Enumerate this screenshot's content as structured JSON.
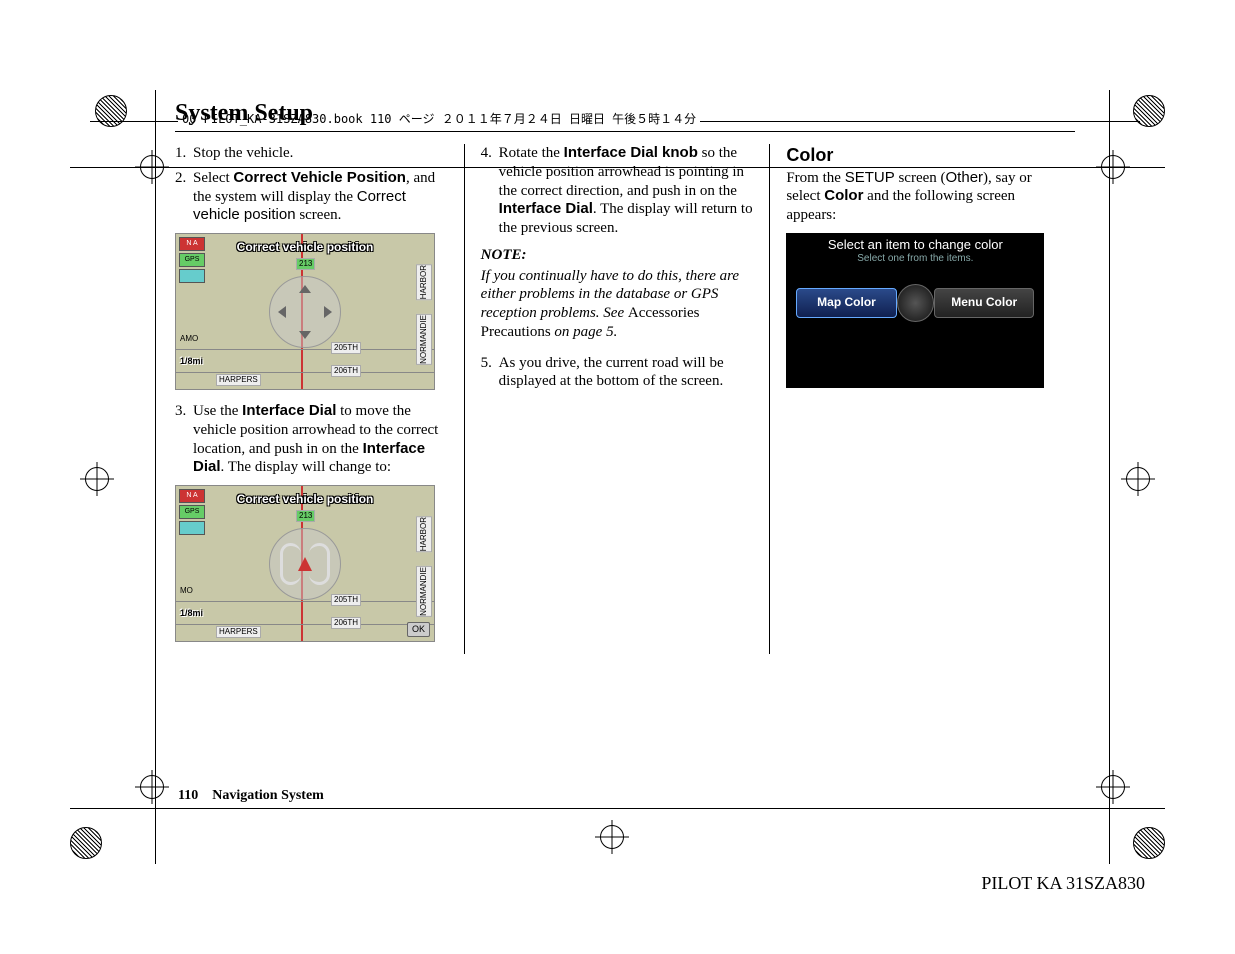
{
  "header_strip": "00 PILOT_KA-31SZA830.book  110 ページ  ２０１１年７月２４日  日曜日  午後５時１４分",
  "title": "System Setup",
  "col1": {
    "step1_num": "1.",
    "step1": "Stop the vehicle.",
    "step2_num": "2.",
    "step2_a": "Select ",
    "step2_b": "Correct Vehicle Position",
    "step2_c": ", and the system will display the ",
    "step2_d": "Correct vehicle position",
    "step2_e": " screen.",
    "shot1": {
      "title": "Correct vehicle position",
      "scale": "1/8mi",
      "na": "N A",
      "gps": "GPS",
      "road_205": "205TH",
      "road_206": "206TH",
      "road_harpers": "HARPERS",
      "road_amo": "AMO",
      "road_harbor": "HARBOR",
      "road_normandie": "NORMANDIE",
      "hwy": "213"
    },
    "step3_num": "3.",
    "step3_a": "Use the ",
    "step3_b": "Interface Dial",
    "step3_c": " to move the vehicle position arrowhead to the correct location, and push in on the ",
    "step3_d": "Interface Dial",
    "step3_e": ". The display will change to:",
    "shot2": {
      "title": "Correct vehicle position",
      "scale": "1/8mi",
      "ok": "OK",
      "road_205": "205TH",
      "road_206": "206TH",
      "road_harpers": "HARPERS",
      "road_mo": "MO",
      "road_harbor": "HARBOR",
      "road_normandie": "NORMANDIE",
      "hwy": "213"
    }
  },
  "col2": {
    "step4_num": "4.",
    "step4_a": "Rotate the ",
    "step4_b": "Interface Dial knob",
    "step4_c": " so the vehicle position arrowhead is pointing in the correct direction, and push in on the ",
    "step4_d": "Interface Dial",
    "step4_e": ". The display will return to the previous screen.",
    "note_head": "NOTE:",
    "note_a": "If you continually have to do this, there are either problems in the database or GPS reception problems. See ",
    "note_b": "Accessories Precautions",
    "note_c": " on page 5.",
    "step5_num": "5.",
    "step5": "As you drive, the current road will be displayed at the bottom of the screen."
  },
  "col3": {
    "heading": "Color",
    "intro_a": "From the ",
    "intro_b": "SETUP",
    "intro_c": " screen (",
    "intro_d": "Other",
    "intro_e": "), say or select ",
    "intro_f": "Color",
    "intro_g": " and the following screen appears:",
    "shot": {
      "title": "Select an item to change color",
      "sub": "Select one from the items.",
      "btn_map": "Map Color",
      "btn_menu": "Menu Color"
    }
  },
  "footer": {
    "page": "110",
    "section": "Navigation System",
    "doc_id": "PILOT KA  31SZA830"
  }
}
